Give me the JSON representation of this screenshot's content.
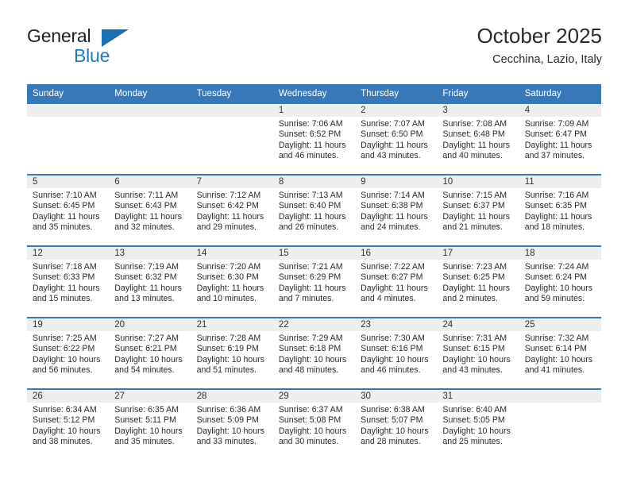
{
  "brand": {
    "name_top": "General",
    "name_bottom": "Blue",
    "triangle_color": "#1a6fb5",
    "blue_color": "#1a7ec4"
  },
  "header": {
    "title": "October 2025",
    "subtitle": "Cecchina, Lazio, Italy",
    "accent_color": "#3878b8"
  },
  "calendar": {
    "weekday_headers": [
      "Sunday",
      "Monday",
      "Tuesday",
      "Wednesday",
      "Thursday",
      "Friday",
      "Saturday"
    ],
    "weeks": [
      [
        {
          "day": "",
          "lines": []
        },
        {
          "day": "",
          "lines": []
        },
        {
          "day": "",
          "lines": []
        },
        {
          "day": "1",
          "lines": [
            "Sunrise: 7:06 AM",
            "Sunset: 6:52 PM",
            "Daylight: 11 hours",
            "and 46 minutes."
          ]
        },
        {
          "day": "2",
          "lines": [
            "Sunrise: 7:07 AM",
            "Sunset: 6:50 PM",
            "Daylight: 11 hours",
            "and 43 minutes."
          ]
        },
        {
          "day": "3",
          "lines": [
            "Sunrise: 7:08 AM",
            "Sunset: 6:48 PM",
            "Daylight: 11 hours",
            "and 40 minutes."
          ]
        },
        {
          "day": "4",
          "lines": [
            "Sunrise: 7:09 AM",
            "Sunset: 6:47 PM",
            "Daylight: 11 hours",
            "and 37 minutes."
          ]
        }
      ],
      [
        {
          "day": "5",
          "lines": [
            "Sunrise: 7:10 AM",
            "Sunset: 6:45 PM",
            "Daylight: 11 hours",
            "and 35 minutes."
          ]
        },
        {
          "day": "6",
          "lines": [
            "Sunrise: 7:11 AM",
            "Sunset: 6:43 PM",
            "Daylight: 11 hours",
            "and 32 minutes."
          ]
        },
        {
          "day": "7",
          "lines": [
            "Sunrise: 7:12 AM",
            "Sunset: 6:42 PM",
            "Daylight: 11 hours",
            "and 29 minutes."
          ]
        },
        {
          "day": "8",
          "lines": [
            "Sunrise: 7:13 AM",
            "Sunset: 6:40 PM",
            "Daylight: 11 hours",
            "and 26 minutes."
          ]
        },
        {
          "day": "9",
          "lines": [
            "Sunrise: 7:14 AM",
            "Sunset: 6:38 PM",
            "Daylight: 11 hours",
            "and 24 minutes."
          ]
        },
        {
          "day": "10",
          "lines": [
            "Sunrise: 7:15 AM",
            "Sunset: 6:37 PM",
            "Daylight: 11 hours",
            "and 21 minutes."
          ]
        },
        {
          "day": "11",
          "lines": [
            "Sunrise: 7:16 AM",
            "Sunset: 6:35 PM",
            "Daylight: 11 hours",
            "and 18 minutes."
          ]
        }
      ],
      [
        {
          "day": "12",
          "lines": [
            "Sunrise: 7:18 AM",
            "Sunset: 6:33 PM",
            "Daylight: 11 hours",
            "and 15 minutes."
          ]
        },
        {
          "day": "13",
          "lines": [
            "Sunrise: 7:19 AM",
            "Sunset: 6:32 PM",
            "Daylight: 11 hours",
            "and 13 minutes."
          ]
        },
        {
          "day": "14",
          "lines": [
            "Sunrise: 7:20 AM",
            "Sunset: 6:30 PM",
            "Daylight: 11 hours",
            "and 10 minutes."
          ]
        },
        {
          "day": "15",
          "lines": [
            "Sunrise: 7:21 AM",
            "Sunset: 6:29 PM",
            "Daylight: 11 hours",
            "and 7 minutes."
          ]
        },
        {
          "day": "16",
          "lines": [
            "Sunrise: 7:22 AM",
            "Sunset: 6:27 PM",
            "Daylight: 11 hours",
            "and 4 minutes."
          ]
        },
        {
          "day": "17",
          "lines": [
            "Sunrise: 7:23 AM",
            "Sunset: 6:25 PM",
            "Daylight: 11 hours",
            "and 2 minutes."
          ]
        },
        {
          "day": "18",
          "lines": [
            "Sunrise: 7:24 AM",
            "Sunset: 6:24 PM",
            "Daylight: 10 hours",
            "and 59 minutes."
          ]
        }
      ],
      [
        {
          "day": "19",
          "lines": [
            "Sunrise: 7:25 AM",
            "Sunset: 6:22 PM",
            "Daylight: 10 hours",
            "and 56 minutes."
          ]
        },
        {
          "day": "20",
          "lines": [
            "Sunrise: 7:27 AM",
            "Sunset: 6:21 PM",
            "Daylight: 10 hours",
            "and 54 minutes."
          ]
        },
        {
          "day": "21",
          "lines": [
            "Sunrise: 7:28 AM",
            "Sunset: 6:19 PM",
            "Daylight: 10 hours",
            "and 51 minutes."
          ]
        },
        {
          "day": "22",
          "lines": [
            "Sunrise: 7:29 AM",
            "Sunset: 6:18 PM",
            "Daylight: 10 hours",
            "and 48 minutes."
          ]
        },
        {
          "day": "23",
          "lines": [
            "Sunrise: 7:30 AM",
            "Sunset: 6:16 PM",
            "Daylight: 10 hours",
            "and 46 minutes."
          ]
        },
        {
          "day": "24",
          "lines": [
            "Sunrise: 7:31 AM",
            "Sunset: 6:15 PM",
            "Daylight: 10 hours",
            "and 43 minutes."
          ]
        },
        {
          "day": "25",
          "lines": [
            "Sunrise: 7:32 AM",
            "Sunset: 6:14 PM",
            "Daylight: 10 hours",
            "and 41 minutes."
          ]
        }
      ],
      [
        {
          "day": "26",
          "lines": [
            "Sunrise: 6:34 AM",
            "Sunset: 5:12 PM",
            "Daylight: 10 hours",
            "and 38 minutes."
          ]
        },
        {
          "day": "27",
          "lines": [
            "Sunrise: 6:35 AM",
            "Sunset: 5:11 PM",
            "Daylight: 10 hours",
            "and 35 minutes."
          ]
        },
        {
          "day": "28",
          "lines": [
            "Sunrise: 6:36 AM",
            "Sunset: 5:09 PM",
            "Daylight: 10 hours",
            "and 33 minutes."
          ]
        },
        {
          "day": "29",
          "lines": [
            "Sunrise: 6:37 AM",
            "Sunset: 5:08 PM",
            "Daylight: 10 hours",
            "and 30 minutes."
          ]
        },
        {
          "day": "30",
          "lines": [
            "Sunrise: 6:38 AM",
            "Sunset: 5:07 PM",
            "Daylight: 10 hours",
            "and 28 minutes."
          ]
        },
        {
          "day": "31",
          "lines": [
            "Sunrise: 6:40 AM",
            "Sunset: 5:05 PM",
            "Daylight: 10 hours",
            "and 25 minutes."
          ]
        },
        {
          "day": "",
          "lines": []
        }
      ]
    ]
  }
}
